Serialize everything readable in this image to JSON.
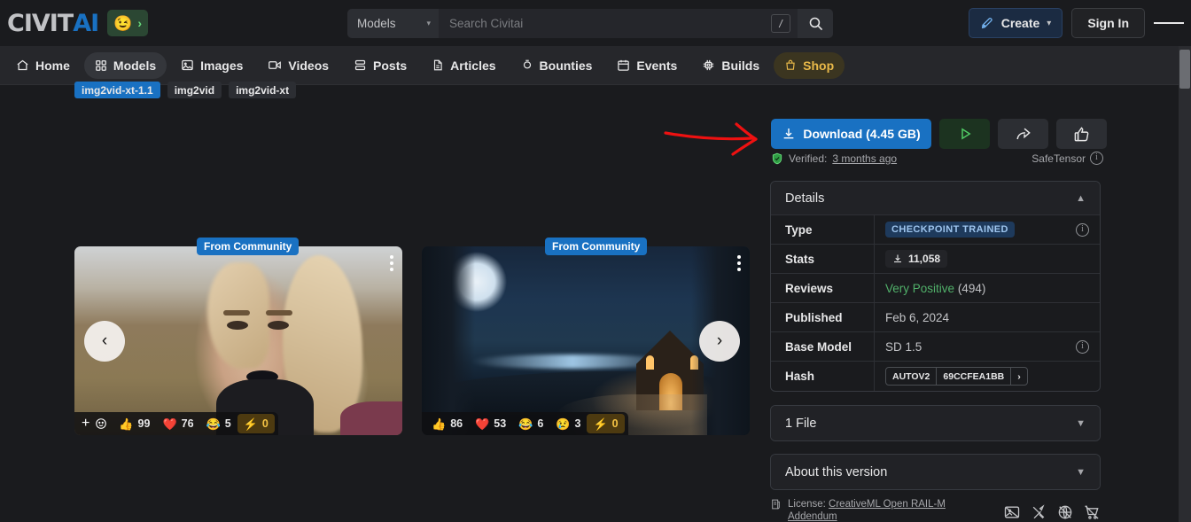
{
  "header": {
    "logo_civit": "CIVIT",
    "logo_ai": "AI",
    "logo_badge_emoji": "😉",
    "logo_badge_chevron": "›",
    "search": {
      "selected_category": "Models",
      "placeholder": "Search Civitai",
      "value": "",
      "shortcut_key": "/"
    },
    "create_label": "Create",
    "signin_label": "Sign In"
  },
  "nav": {
    "items": [
      {
        "label": "Home",
        "icon": "home-icon",
        "active": false
      },
      {
        "label": "Models",
        "icon": "grid-icon",
        "active": true
      },
      {
        "label": "Images",
        "icon": "image-icon",
        "active": false
      },
      {
        "label": "Videos",
        "icon": "video-icon",
        "active": false
      },
      {
        "label": "Posts",
        "icon": "posts-icon",
        "active": false
      },
      {
        "label": "Articles",
        "icon": "article-icon",
        "active": false
      },
      {
        "label": "Bounties",
        "icon": "bounty-icon",
        "active": false
      },
      {
        "label": "Events",
        "icon": "calendar-icon",
        "active": false
      },
      {
        "label": "Builds",
        "icon": "chip-icon",
        "active": false
      },
      {
        "label": "Shop",
        "icon": "shop-bag-icon",
        "active": false
      }
    ]
  },
  "tags": [
    {
      "label": "img2vid-xt-1.1",
      "selected": true
    },
    {
      "label": "img2vid",
      "selected": false
    },
    {
      "label": "img2vid-xt",
      "selected": false
    }
  ],
  "gallery": {
    "badge_label": "From Community",
    "prev_label": "‹",
    "next_label": "›",
    "cards": [
      {
        "alt": "blonde woman with braid and black lipstick in a field",
        "reactions": [
          {
            "emoji": "👍",
            "count": "99"
          },
          {
            "emoji": "❤️",
            "count": "76"
          },
          {
            "emoji": "😂",
            "count": "5"
          },
          {
            "emoji": "⚡",
            "count": "0",
            "highlight": true
          }
        ]
      },
      {
        "alt": "moonlit night scene with cottage on a hill",
        "reactions": [
          {
            "emoji": "👍",
            "count": "86"
          },
          {
            "emoji": "❤️",
            "count": "53"
          },
          {
            "emoji": "😂",
            "count": "6"
          },
          {
            "emoji": "😢",
            "count": "3"
          },
          {
            "emoji": "⚡",
            "count": "0",
            "highlight": true
          }
        ]
      }
    ]
  },
  "actions": {
    "download_label": "Download (4.45 GB)",
    "run_label": "▶",
    "share_label": "share-icon",
    "like_label": "thumbs-up-icon",
    "verified_prefix": "Verified:",
    "verified_date": "3 months ago",
    "safetensor_label": "SafeTensor"
  },
  "details": {
    "title": "Details",
    "rows": [
      {
        "key": "Type",
        "value": "CHECKPOINT TRAINED",
        "style": "chip",
        "info": true
      },
      {
        "key": "Stats",
        "value": "11,058",
        "style": "stats",
        "info": false
      },
      {
        "key": "Reviews",
        "value": "Very Positive",
        "value2": "(494)",
        "style": "reviews",
        "info": false
      },
      {
        "key": "Published",
        "value": "Feb 6, 2024",
        "style": "plain",
        "info": false
      },
      {
        "key": "Base Model",
        "value": "SD 1.5",
        "style": "plain",
        "info": true
      },
      {
        "key": "Hash",
        "value": "AUTOV2",
        "value2": "69CCFEA1BB",
        "style": "hash",
        "info": false
      }
    ]
  },
  "file_panel": {
    "title": "1 File"
  },
  "about_panel": {
    "title": "About this version"
  },
  "license": {
    "prefix": "License:",
    "link": "CreativeML Open RAIL-M Addendum",
    "permission_icons": [
      "no-image-credit-icon",
      "no-sell-images-icon",
      "no-civitai-generation-icon",
      "no-selling-models-icon"
    ]
  },
  "annotation": {
    "type": "red-arrow",
    "color": "#ee1111",
    "points_to": "download-button"
  }
}
